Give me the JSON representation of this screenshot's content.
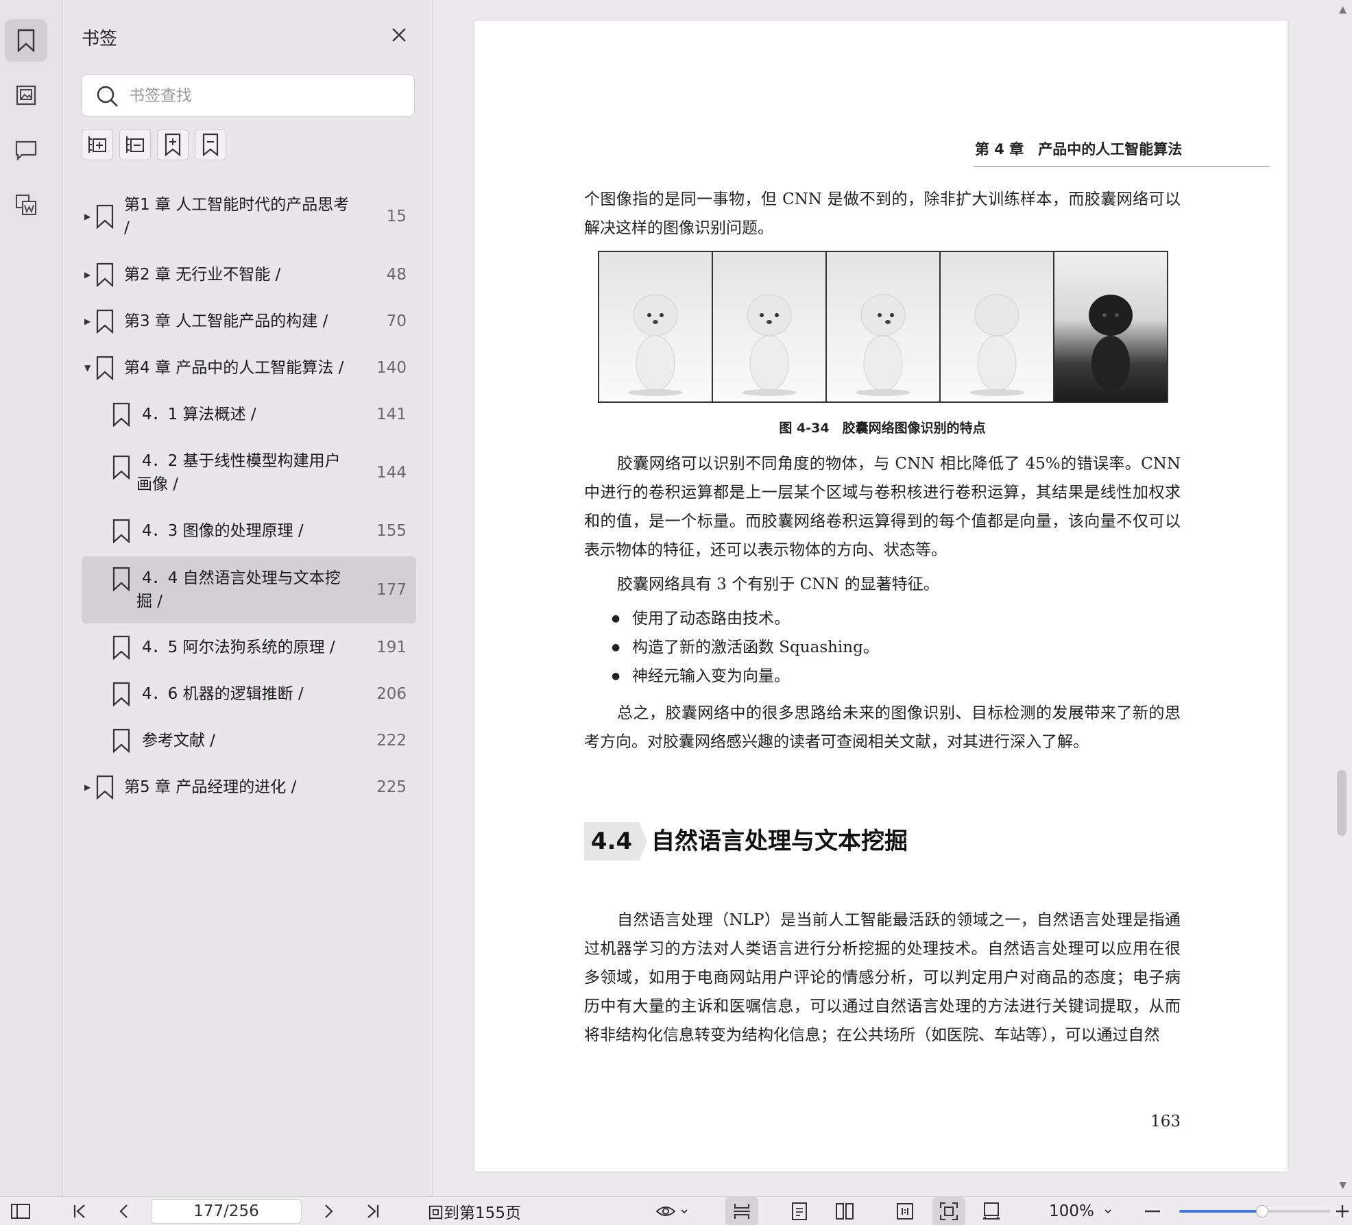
{
  "sidebar": {
    "title": "书签",
    "search_placeholder": "书签查找",
    "rail_icons": [
      "bookmark-icon",
      "image-icon",
      "comment-icon",
      "word-export-icon"
    ],
    "toolbar_icons": [
      "expand-all-icon",
      "collapse-all-icon",
      "add-bookmark-icon",
      "remove-bookmark-icon"
    ],
    "bookmarks": [
      {
        "label": "第1 章 人工智能时代的产品思考 /",
        "page": "15",
        "level": 0,
        "arrow": "▶"
      },
      {
        "label": "第2 章 无行业不智能 /",
        "page": "48",
        "level": 0,
        "arrow": "▶"
      },
      {
        "label": "第3 章 人工智能产品的构建 /",
        "page": "70",
        "level": 0,
        "arrow": "▶"
      },
      {
        "label": "第4 章 产品中的人工智能算法 /",
        "page": "140",
        "level": 0,
        "arrow": "▼"
      },
      {
        "label": "4．1 算法概述 /",
        "page": "141",
        "level": 1
      },
      {
        "label": "4．2 基于线性模型构建用户画像 /",
        "page": "144",
        "level": 1
      },
      {
        "label": "4．3 图像的处理原理 /",
        "page": "155",
        "level": 1
      },
      {
        "label": "4．4 自然语言处理与文本挖掘 /",
        "page": "177",
        "level": 1,
        "selected": true
      },
      {
        "label": "4．5 阿尔法狗系统的原理 /",
        "page": "191",
        "level": 1
      },
      {
        "label": "4．6 机器的逻辑推断 /",
        "page": "206",
        "level": 1
      },
      {
        "label": "参考文献 /",
        "page": "222",
        "level": 1
      },
      {
        "label": "第5 章 产品经理的进化 /",
        "page": "225",
        "level": 0,
        "arrow": "▶"
      }
    ]
  },
  "document": {
    "running_header": "第 4 章　产品中的人工智能算法",
    "para1": "个图像指的是同一事物，但 CNN 是做不到的，除非扩大训练样本，而胶囊网络可以解决这样的图像识别问题。",
    "figure_caption": "图 4-34　胶囊网络图像识别的特点",
    "para2": "胶囊网络可以识别不同角度的物体，与 CNN 相比降低了 45%的错误率。CNN 中进行的卷积运算都是上一层某个区域与卷积核进行卷积运算，其结果是线性加权求和的值，是一个标量。而胶囊网络卷积运算得到的每个值都是向量，该向量不仅可以表示物体的特征，还可以表示物体的方向、状态等。",
    "para3": "胶囊网络具有 3 个有别于 CNN 的显著特征。",
    "bullets": [
      "使用了动态路由技术。",
      "构造了新的激活函数 Squashing。",
      "神经元输入变为向量。"
    ],
    "para4": "总之，胶囊网络中的很多思路给未来的图像识别、目标检测的发展带来了新的思考方向。对胶囊网络感兴趣的读者可查阅相关文献，对其进行深入了解。",
    "section_number": "4.4",
    "section_title": "自然语言处理与文本挖掘",
    "para5": "自然语言处理（NLP）是当前人工智能最活跃的领域之一，自然语言处理是指通过机器学习的方法对人类语言进行分析挖掘的处理技术。自然语言处理可以应用在很多领域，如用于电商网站用户评论的情感分析，可以判定用户对商品的态度；电子病历中有大量的主诉和医嘱信息，可以通过自然语言处理的方法进行关键词提取，从而将非结构化信息转变为结构化信息；在公共场所（如医院、车站等），可以通过自然",
    "page_number": "163"
  },
  "status_bar": {
    "page_value": "177/256",
    "goto_text": "回到第155页",
    "zoom": "100%",
    "zoom_fraction": 0.55
  },
  "colors": {
    "accent": "#3d7be0",
    "selected_row": "#d3d0d5"
  }
}
